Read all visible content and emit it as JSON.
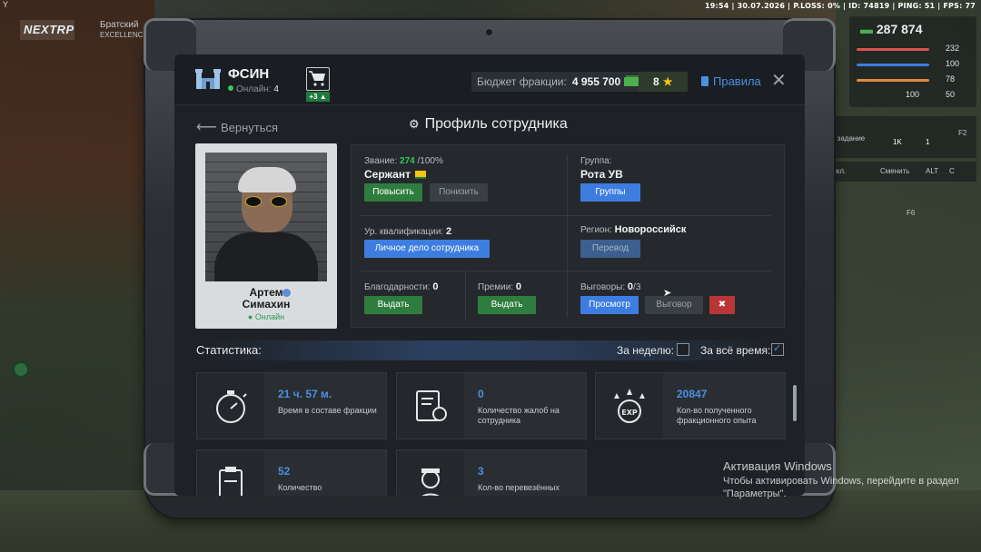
{
  "hud": {
    "top_bar": "19:54 | 30.07.2026 | P.LOSS: 0% | ID: 74819 | PING: 51 | FPS: 77",
    "corner_letter": "Y",
    "logo": "NEXTRP",
    "server": "Братский",
    "server_sub": "EXCELLENCE",
    "money": "287 874",
    "stats": [
      "232",
      "100",
      "78",
      "50"
    ],
    "armor_mini": "100",
    "task_label": "е задание",
    "reward_money": "1K",
    "reward_coin": "1",
    "f2": "F2",
    "off_label": "ыкл.",
    "switch_label": "Сменить",
    "alt": "ALT",
    "c_key": "C",
    "f6": "F6"
  },
  "header": {
    "faction_name": "ФСИН",
    "online_label": "Онлайн:",
    "online_count": "4",
    "cart_badge": "+3",
    "budget_label": "Бюджет фракции:",
    "budget_value": "4 955 700",
    "level": "8",
    "rules_label": "Правила",
    "close_symbol": "✕"
  },
  "nav": {
    "back_label": "Вернуться",
    "page_title": "Профиль сотрудника"
  },
  "employee": {
    "first_name": "Артем",
    "last_name": "Симахин",
    "status": "Онлайн"
  },
  "info": {
    "rank_label": "Звание:",
    "rank_points": "274",
    "rank_max": "/100%",
    "rank_name": "Сержант",
    "promote_btn": "Повысить",
    "demote_btn": "Понизить",
    "group_label": "Группа:",
    "group_name": "Рота УВ",
    "groups_btn": "Группы",
    "qual_label": "Ур. квалификации:",
    "qual_value": "2",
    "personal_file_btn": "Личное дело сотрудника",
    "region_label": "Регион:",
    "region_value": "Новороссийск",
    "transfer_btn": "Перевод",
    "thanks_label": "Благодарности:",
    "thanks_value": "0",
    "thanks_btn": "Выдать",
    "bonus_label": "Премии:",
    "bonus_value": "0",
    "bonus_btn": "Выдать",
    "reprimand_label": "Выговоры:",
    "reprimand_value": "0",
    "reprimand_max": "/3",
    "view_btn": "Просмотр",
    "reprimand_btn": "Выговор"
  },
  "stats": {
    "title": "Статистика:",
    "week_label": "За неделю:",
    "week_checked": false,
    "all_time_label": "За всё время:",
    "all_time_checked": true,
    "tiles": [
      {
        "value": "21 ч. 57 м.",
        "desc": "Время в составе фракции",
        "icon": "stopwatch-icon"
      },
      {
        "value": "0",
        "desc": "Количество жалоб на сотрудника",
        "icon": "complaint-icon"
      },
      {
        "value": "20847",
        "desc": "Кол-во полученного фракционного опыта",
        "icon": "exp-icon"
      },
      {
        "value": "52",
        "desc": "Количество",
        "icon": "clipboard-icon"
      },
      {
        "value": "3",
        "desc": "Кол-во перевезённых",
        "icon": "prisoner-icon"
      }
    ]
  },
  "windows": {
    "activation_title": "Активация Windows",
    "activation_line1": "Чтобы активировать Windows, перейдите в раздел",
    "activation_line2": "\"Параметры\"."
  },
  "colors": {
    "accent_blue": "#3d7de0",
    "accent_green": "#2f7d3e",
    "danger_red": "#b93636",
    "online_green": "#34c759",
    "gold": "#f5c518"
  }
}
